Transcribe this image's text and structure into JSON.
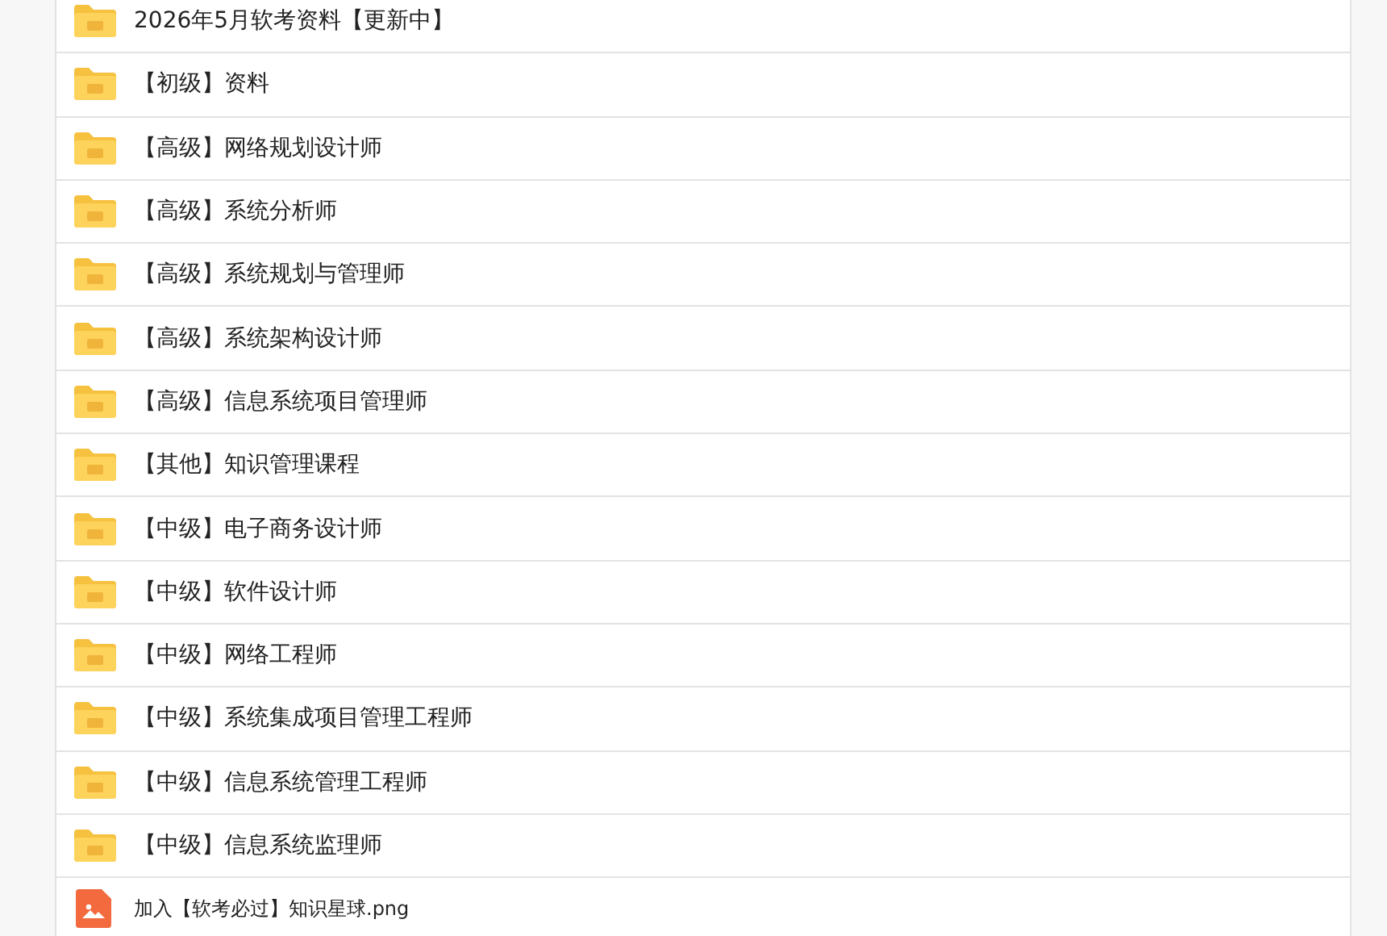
{
  "files": [
    {
      "kind": "folder",
      "name": "2026年5月软考资料【更新中】"
    },
    {
      "kind": "folder",
      "name": "【初级】资料"
    },
    {
      "kind": "folder",
      "name": "【高级】网络规划设计师"
    },
    {
      "kind": "folder",
      "name": "【高级】系统分析师"
    },
    {
      "kind": "folder",
      "name": "【高级】系统规划与管理师"
    },
    {
      "kind": "folder",
      "name": "【高级】系统架构设计师"
    },
    {
      "kind": "folder",
      "name": "【高级】信息系统项目管理师"
    },
    {
      "kind": "folder",
      "name": "【其他】知识管理课程"
    },
    {
      "kind": "folder",
      "name": "【中级】电子商务设计师"
    },
    {
      "kind": "folder",
      "name": "【中级】软件设计师"
    },
    {
      "kind": "folder",
      "name": "【中级】网络工程师"
    },
    {
      "kind": "folder",
      "name": "【中级】系统集成项目管理工程师"
    },
    {
      "kind": "folder",
      "name": "【中级】信息系统管理工程师"
    },
    {
      "kind": "folder",
      "name": "【中级】信息系统监理师"
    },
    {
      "kind": "image",
      "name": "加入【软考必过】知识星球.png"
    }
  ]
}
